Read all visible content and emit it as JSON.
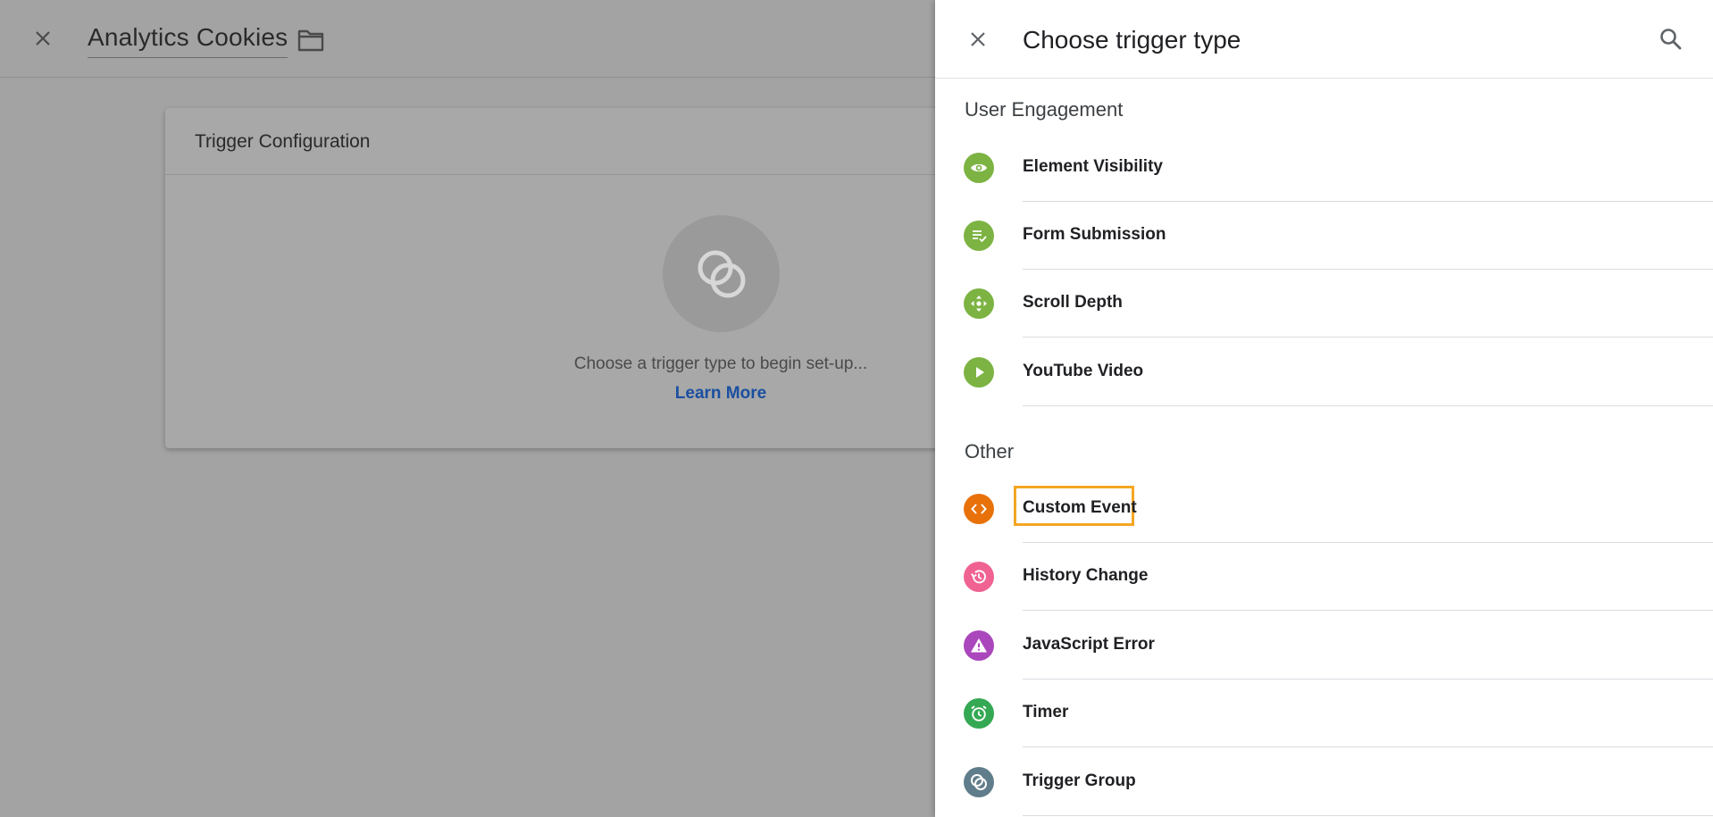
{
  "editor": {
    "title": "Analytics Cookies",
    "card_title": "Trigger Configuration",
    "hint": "Choose a trigger type to begin set-up...",
    "learn_more": "Learn More"
  },
  "drawer": {
    "title": "Choose trigger type",
    "sections": [
      {
        "title": "User Engagement",
        "items": [
          {
            "label": "Element Visibility",
            "icon": "eye-icon",
            "color": "#7cb342"
          },
          {
            "label": "Form Submission",
            "icon": "form-check-icon",
            "color": "#7cb342"
          },
          {
            "label": "Scroll Depth",
            "icon": "scroll-arrows-icon",
            "color": "#7cb342"
          },
          {
            "label": "YouTube Video",
            "icon": "play-icon",
            "color": "#7cb342"
          }
        ]
      },
      {
        "title": "Other",
        "items": [
          {
            "label": "Custom Event",
            "icon": "code-icon",
            "color": "#e8710a",
            "highlighted": true
          },
          {
            "label": "History Change",
            "icon": "history-icon",
            "color": "#f06292"
          },
          {
            "label": "JavaScript Error",
            "icon": "warning-icon",
            "color": "#ab47bc"
          },
          {
            "label": "Timer",
            "icon": "alarm-icon",
            "color": "#34a853"
          },
          {
            "label": "Trigger Group",
            "icon": "trigger-group-icon",
            "color": "#607d8b"
          }
        ]
      }
    ]
  }
}
